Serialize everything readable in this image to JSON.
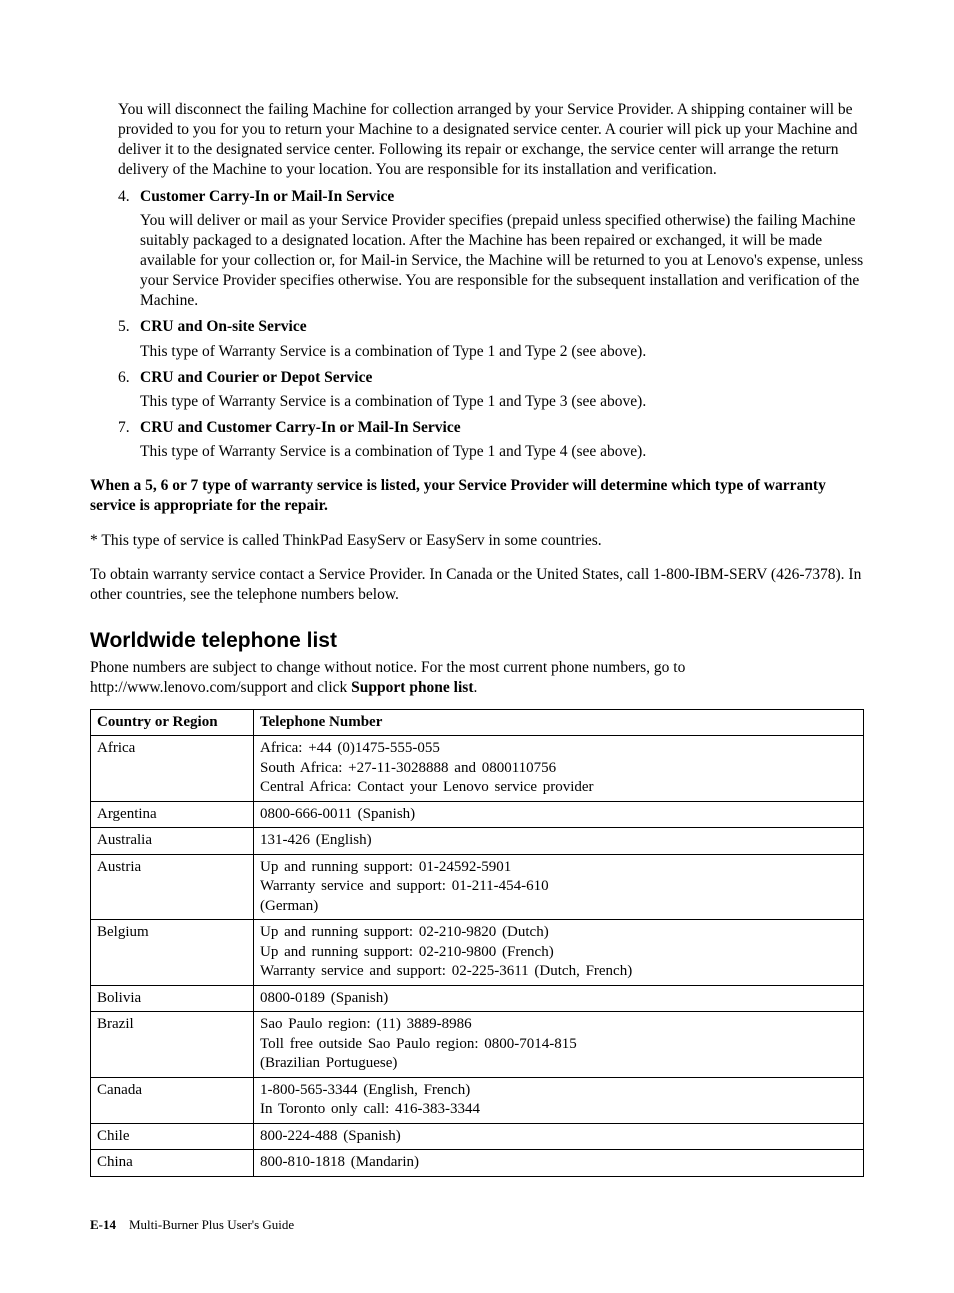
{
  "intro_para": "You will disconnect the failing Machine for collection arranged by your Service Provider. A shipping container will be provided to you for you to return your Machine to a designated service center. A courier will pick up your Machine and deliver it to the designated service center. Following its repair or exchange, the service center will arrange the return delivery of the Machine to your location. You are responsible for its installation and verification.",
  "items": [
    {
      "num": "4.",
      "title": "Customer Carry-In or Mail-In Service",
      "para": "You will deliver or mail as your Service Provider specifies (prepaid unless specified otherwise) the failing Machine suitably packaged to a designated location. After the Machine has been repaired or exchanged, it will be made available for your collection or, for Mail-in Service, the Machine will be returned to you at Lenovo's expense, unless your Service Provider specifies otherwise. You are responsible for the subsequent installation and verification of the Machine."
    },
    {
      "num": "5.",
      "title": "CRU and On-site Service",
      "para": "This type of Warranty Service is a combination of Type 1 and Type 2 (see above)."
    },
    {
      "num": "6.",
      "title": "CRU and Courier or Depot Service",
      "para": "This type of Warranty Service is a combination of Type 1 and Type 3 (see above)."
    },
    {
      "num": "7.",
      "title": "CRU and Customer Carry-In or Mail-In Service",
      "para": "This type of Warranty Service is a combination of Type 1 and Type 4 (see above)."
    }
  ],
  "bold_note": "When a 5, 6 or 7 type of warranty service is listed, your Service Provider will determine which type of warranty service is appropriate for the repair.",
  "asterisk_note": "* This type of service is called ThinkPad EasyServ or EasyServ in some countries.",
  "contact_note": "To obtain warranty service contact a Service Provider. In Canada or the United States, call 1-800-IBM-SERV (426-7378). In other countries, see the telephone numbers below.",
  "section_heading": "Worldwide telephone list",
  "section_intro_a": "Phone numbers are subject to change without notice. For the most current phone numbers, go to http://www.lenovo.com/support and click ",
  "section_intro_bold": "Support phone list",
  "section_intro_b": ".",
  "table": {
    "head_country": "Country or Region",
    "head_phone": "Telephone Number",
    "rows": [
      {
        "country": "Africa",
        "lines": [
          "Africa: +44 (0)1475-555-055",
          "South Africa: +27-11-3028888 and 0800110756",
          "Central Africa: Contact your Lenovo service provider"
        ]
      },
      {
        "country": "Argentina",
        "lines": [
          "0800-666-0011 (Spanish)"
        ]
      },
      {
        "country": "Australia",
        "lines": [
          "131-426 (English)"
        ]
      },
      {
        "country": "Austria",
        "lines": [
          "Up and running support: 01-24592-5901",
          "Warranty service and support: 01-211-454-610",
          "(German)"
        ]
      },
      {
        "country": "Belgium",
        "lines": [
          "Up and running support: 02-210-9820 (Dutch)",
          "Up and running support: 02-210-9800 (French)",
          "Warranty service and support: 02-225-3611 (Dutch, French)"
        ]
      },
      {
        "country": "Bolivia",
        "lines": [
          "0800-0189 (Spanish)"
        ]
      },
      {
        "country": "Brazil",
        "lines": [
          "Sao Paulo region: (11) 3889-8986",
          "Toll free outside Sao Paulo region: 0800-7014-815",
          "(Brazilian Portuguese)"
        ]
      },
      {
        "country": "Canada",
        "lines": [
          "1-800-565-3344 (English, French)",
          "In Toronto only call: 416-383-3344"
        ]
      },
      {
        "country": "Chile",
        "lines": [
          "800-224-488 (Spanish)"
        ]
      },
      {
        "country": "China",
        "lines": [
          "800-810-1818 (Mandarin)"
        ]
      }
    ]
  },
  "footer": {
    "page": "E-14",
    "title": "Multi-Burner Plus User's Guide"
  }
}
